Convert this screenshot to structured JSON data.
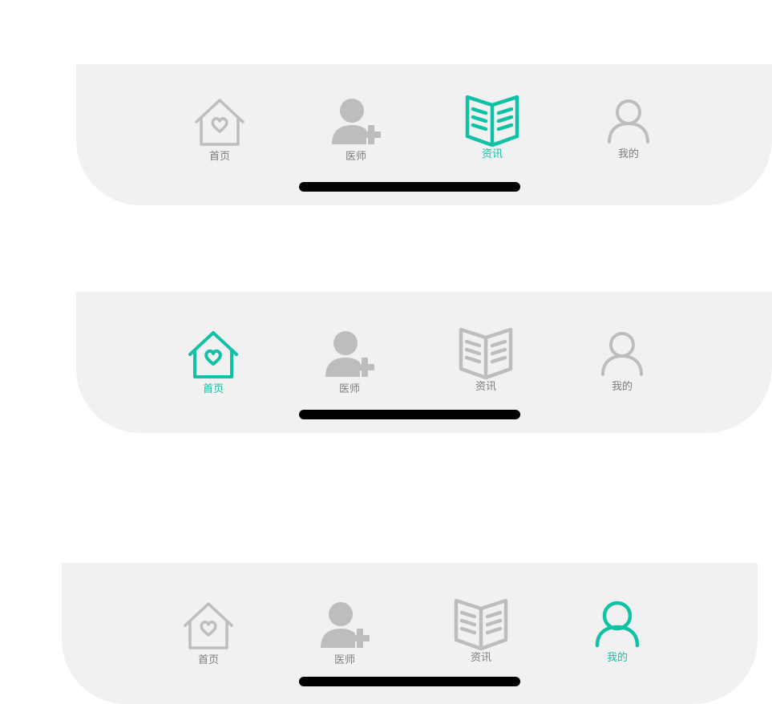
{
  "colors": {
    "active": "#11c1a6",
    "inactive": "#bdbdbd",
    "label_inactive": "#7d7d7d",
    "bar_bg": "#f1f1f1"
  },
  "tabbars": [
    {
      "active_tab": "资讯",
      "tabs": [
        {
          "label": "首页",
          "icon": "house-heart-icon"
        },
        {
          "label": "医师",
          "icon": "doctor-add-icon"
        },
        {
          "label": "资讯",
          "icon": "open-book-icon"
        },
        {
          "label": "我的",
          "icon": "user-icon"
        }
      ]
    },
    {
      "active_tab": "首页",
      "tabs": [
        {
          "label": "首页",
          "icon": "house-heart-icon"
        },
        {
          "label": "医师",
          "icon": "doctor-add-icon"
        },
        {
          "label": "资讯",
          "icon": "open-book-icon"
        },
        {
          "label": "我的",
          "icon": "user-icon"
        }
      ]
    },
    {
      "active_tab": "我的",
      "tabs": [
        {
          "label": "首页",
          "icon": "house-heart-icon"
        },
        {
          "label": "医师",
          "icon": "doctor-add-icon"
        },
        {
          "label": "资讯",
          "icon": "open-book-icon"
        },
        {
          "label": "我的",
          "icon": "user-icon"
        }
      ]
    }
  ]
}
